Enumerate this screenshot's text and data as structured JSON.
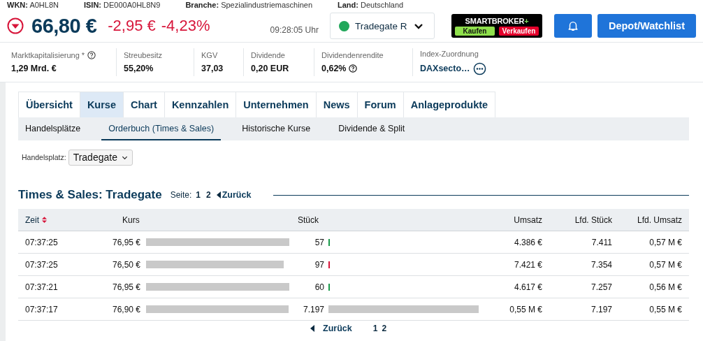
{
  "info_line": [
    {
      "label": "WKN:",
      "value": "A0HL8N"
    },
    {
      "label": "ISIN:",
      "value": "DE000A0HL8N9"
    },
    {
      "label": "Branche:",
      "value": "Spezialindustriemaschinen"
    },
    {
      "label": "Land:",
      "value": "Deutschland"
    }
  ],
  "quote": {
    "falling": true,
    "price": "66,80 €",
    "change": "-2,95 €",
    "change_percent": "-4,23%",
    "time": "09:28:05 Uhr"
  },
  "exchange_select": {
    "value": "Tradegate R",
    "open": true
  },
  "broker": {
    "name": "SMARTBROKER",
    "plus": "+",
    "buy": "Kaufen",
    "sell": "Verkaufen"
  },
  "buttons": [
    {
      "kind": "bell"
    },
    {
      "kind": "text",
      "label": "Depot/Watchlist"
    }
  ],
  "stats": [
    {
      "label": "Marktkapitalisierung *",
      "value": "1,29 Mrd. €",
      "label_help": true
    },
    {
      "label": "Streubesitz",
      "value": "55,20%"
    },
    {
      "label": "KGV",
      "value": "37,03"
    },
    {
      "label": "Dividende",
      "value": "0,20 EUR"
    },
    {
      "label": "Dividendenrendite",
      "value": "0,62%",
      "value_help": true
    },
    {
      "label": "Index-Zuordnung",
      "value": "DAXsecto…",
      "link": true,
      "more": true
    }
  ],
  "tabs": [
    {
      "label": "Übersicht",
      "selected": false
    },
    {
      "label": "Kurse",
      "selected": true
    },
    {
      "label": "Chart",
      "selected": false
    },
    {
      "label": "Kennzahlen",
      "selected": false
    },
    {
      "label": "Unternehmen",
      "selected": false
    },
    {
      "label": "News",
      "selected": false
    },
    {
      "label": "Forum",
      "selected": false
    },
    {
      "label": "Anlageprodukte",
      "selected": false
    }
  ],
  "subtabs": [
    {
      "label": "Handelsplätze",
      "selected": false
    },
    {
      "label": "Orderbuch (Times & Sales)",
      "selected": true
    },
    {
      "label": "Historische Kurse",
      "selected": false
    },
    {
      "label": "Dividende & Split",
      "selected": false
    }
  ],
  "filter": {
    "label": "Handelsplatz:",
    "value": "Tradegate"
  },
  "section": {
    "title": "Times & Sales: Tradegate",
    "pager_label": "Seite:",
    "pages": [
      "1",
      "2"
    ],
    "back": "Zurück"
  },
  "table": {
    "columns": [
      {
        "label": "Zeit",
        "sortable": true
      },
      {
        "label": "Kurs"
      },
      {
        "label": "Stück"
      },
      {
        "label": "Umsatz"
      },
      {
        "label": "Lfd. Stück"
      },
      {
        "label": "Lfd. Umsatz"
      }
    ],
    "rows": [
      {
        "time": "07:37:25",
        "price": "76,95 €",
        "volume": "57",
        "tick": {
          "up": true
        },
        "turnover": "4.386 €",
        "cum_volume": "7.411",
        "cum_turnover": "0,57 M €"
      },
      {
        "time": "07:37:25",
        "price": "76,50 €",
        "volume": "97",
        "tick": {
          "up": false
        },
        "turnover": "7.421 €",
        "cum_volume": "7.354",
        "cum_turnover": "0,57 M €"
      },
      {
        "time": "07:37:21",
        "price": "76,95 €",
        "volume": "60",
        "tick": {
          "up": true
        },
        "turnover": "4.617 €",
        "cum_volume": "7.257",
        "cum_turnover": "0,56 M €"
      },
      {
        "time": "07:37:17",
        "price": "76,90 €",
        "volume": "7.197",
        "turnover": "0,55 M €",
        "cum_volume": "7.197",
        "cum_turnover": "0,55 M €"
      }
    ]
  },
  "bottom_pager": {
    "back": "Zurück",
    "pages": [
      "1",
      "2"
    ]
  }
}
